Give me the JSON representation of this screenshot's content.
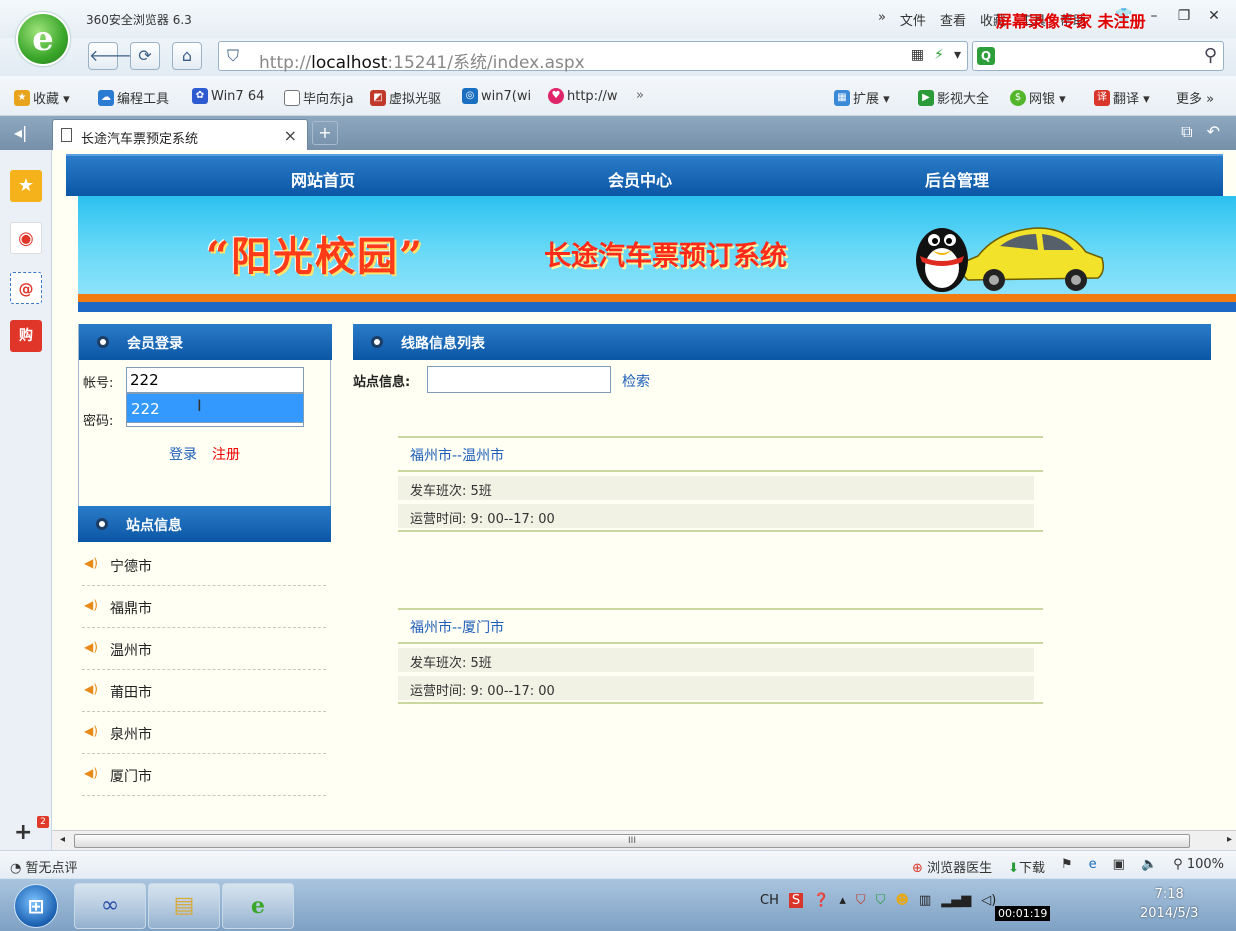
{
  "browser": {
    "app_title": "360安全浏览器 6.3",
    "menu": [
      "»",
      "文件",
      "查看",
      "收藏",
      "工具",
      "帮助"
    ],
    "url_prefix": "http://",
    "url_host": "localhost",
    "url_rest": ":15241/系统/index.aspx",
    "watermark": "屏幕录像专家 未注册"
  },
  "favorites": [
    {
      "icon": "favorites-star-icon",
      "label": "收藏 ▾"
    },
    {
      "icon": "program-tools-icon",
      "label": "编程工具"
    },
    {
      "icon": "baidu-paw-icon",
      "label": "Win7 64"
    },
    {
      "icon": "page-icon",
      "label": "毕向东ja"
    },
    {
      "icon": "virtual-drive-icon",
      "label": "虚拟光驱"
    },
    {
      "icon": "win7-icon",
      "label": "win7(wi"
    },
    {
      "icon": "shop-icon",
      "label": "http://w"
    }
  ],
  "favorites_right": [
    {
      "icon": "extensions-icon",
      "label": "扩展 ▾"
    },
    {
      "icon": "video-icon",
      "label": "影视大全"
    },
    {
      "icon": "bank-icon",
      "label": "网银 ▾"
    },
    {
      "icon": "translate-icon",
      "label": "翻译 ▾"
    },
    {
      "icon": "more-icon",
      "label": "更多 »"
    }
  ],
  "tab": {
    "title": "长途汽车票预定系统"
  },
  "site": {
    "nav": [
      "网站首页",
      "会员中心",
      "后台管理"
    ],
    "banner_slogan": "“阳光校园”",
    "banner_title": "长途汽车票预订系统"
  },
  "login": {
    "header": "会员登录",
    "account_label": "帐号:",
    "password_label": "密码:",
    "account_value": "222",
    "suggestion": "222",
    "login_label": "登录",
    "register_label": "注册"
  },
  "stations": {
    "header": "站点信息",
    "items": [
      "宁德市",
      "福鼎市",
      "温州市",
      "莆田市",
      "泉州市",
      "厦门市"
    ]
  },
  "routes": {
    "header": "线路信息列表",
    "search_label": "站点信息:",
    "search_button": "检索",
    "items": [
      {
        "title": "福州市--温州市",
        "trips": "发车班次: 5班",
        "hours": "运营时间: 9: 00--17: 00"
      },
      {
        "title": "福州市--厦门市",
        "trips": "发车班次: 5班",
        "hours": "运营时间: 9: 00--17: 00"
      }
    ]
  },
  "status": {
    "left": "暂无点评",
    "right": [
      "浏览器医生",
      "下载",
      "100%"
    ]
  },
  "taskbar": {
    "tray_lang": "CH",
    "timer": "00:01:19",
    "time": "7:18",
    "date": "2014/5/3"
  },
  "colors": {
    "accent": "#0b56a5",
    "link": "#1f5fb8",
    "register": "#ee0000",
    "page_bg": "#fffff4"
  }
}
